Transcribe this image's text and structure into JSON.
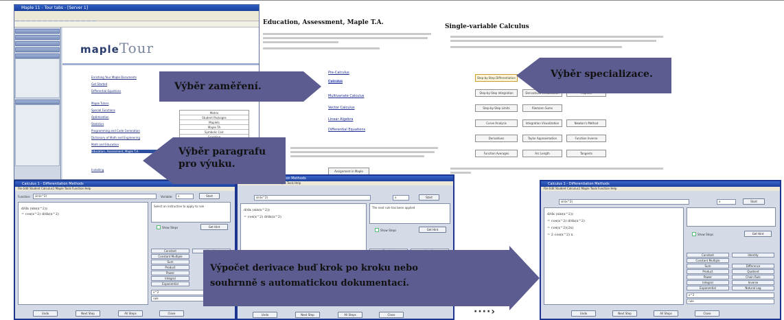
{
  "maple_window": {
    "title": "Maple 11 - Tour tabs - [Server 1]",
    "logo_small": "maple",
    "logo_large": "Tour",
    "topics": [
      "Enriching Your Maple Documents",
      "Get Started",
      "Differential Equations",
      "Maple Tutors",
      "Special Functions",
      "Optimization",
      "Statistics",
      "Programming and Code Generation",
      "Dictionary of Math and Engineering",
      "Math and Education",
      "Education, Assessment, Maple T.A.",
      "Installing"
    ],
    "table_rows": [
      "Matrix",
      "Student Packages",
      "Maplets",
      "Maple TA",
      "Symbolic Calc",
      "Graphing",
      "Applications",
      "Engineering",
      "Special Functions",
      "Systems Identification",
      "Signal Processing",
      "Learn More"
    ]
  },
  "page_education": {
    "heading": "Education, Assessment, Maple T.A.",
    "links": [
      "Pre-Calculus",
      "Calculus",
      "Multivariate Calculus",
      "Vector Calculus",
      "Linear Algebra",
      "Differential Equations"
    ],
    "button": "Assignment in Maple"
  },
  "page_calculus": {
    "heading": "Single-variable Calculus",
    "buttons": [
      "Step-by-Step Differentiation",
      "Step-by-Step Integration",
      "Derivatives Visualization",
      "Maplets",
      "Step-by-Step Limits",
      "Riemann Sums",
      "Curve Analysis",
      "Integration Visualization",
      "Newton's Method",
      "Derivatives",
      "Taylor Approximation",
      "Function Inverse",
      "Function Averages",
      "Arc Length",
      "Tangents"
    ]
  },
  "calc_windows": [
    {
      "title": "Calculus 1 - Differentiation Methods",
      "menu": "File  Edit  Student Calculus1  Maple Tools  Function  Help",
      "function_label": "Function:",
      "function_value": "sin(x^2)",
      "variable_label": "Variable:",
      "variable_value": "x",
      "start_label": "Start",
      "hint": "Select an instruction to apply to rule",
      "math": [
        "d/dx (sin(x^2))",
        "= cos(x^2) d/dx(x^2)"
      ],
      "show_steps_label": "Show Steps",
      "get_hint_label": "Get Hint",
      "rules": [
        "Constant",
        "Identity",
        "Constant Multiple",
        "Sum",
        "Difference",
        "Product",
        "Quotient",
        "Power",
        "Chain Rule",
        "Integral",
        "Inverse",
        "Exponential",
        "Natural Log"
      ],
      "dropdowns": [
        "x^2",
        "rule"
      ],
      "bottom": [
        "Undo",
        "Next Step",
        "All Steps",
        "Close"
      ]
    },
    {
      "title": "Calculus 1 - Differentiation Methods",
      "menu": "File  Edit  Student Calculus1  Maple Tools  Help",
      "function_value": "sin(x^2)",
      "variable_value": "x",
      "start_label": "Start",
      "hint": "The next rule has been applied",
      "math": [
        "d/dx (sin(x^2))",
        "= cos(x^2) d/dx(x^2)"
      ],
      "show_steps_label": "Show Steps",
      "get_hint_label": "Get Hint",
      "rules": [
        "Constant",
        "Identity"
      ],
      "bottom": [
        "Undo",
        "Next Step",
        "All Steps",
        "Close"
      ]
    },
    {
      "title": "Calculus 1 - Differentiation Methods",
      "menu": "File  Edit  Student Calculus1  Maple Tools  Function  Help",
      "function_value": "sin(x^2)",
      "variable_value": "x",
      "start_label": "Start",
      "math": [
        "d/dx (sin(x^2))",
        "= cos(x^2) d/dx(x^2)",
        "= cos(x^2)(2x)",
        "= 2 cos(x^2) x"
      ],
      "show_steps_label": "Show Steps",
      "get_hint_label": "Get Hint",
      "rules": [
        "Constant",
        "Identity",
        "Constant Multiple",
        "Sum",
        "Difference",
        "Product",
        "Quotient",
        "Power",
        "Chain Rule",
        "Integral",
        "Inverse",
        "Exponential",
        "Natural Log"
      ],
      "dropdowns": [
        "x^2",
        "rule"
      ],
      "bottom": [
        "Undo",
        "Next Step",
        "All Steps",
        "Close"
      ]
    }
  ],
  "callouts": {
    "focus": "Výběr zaměření.",
    "specialization": "Výběr specializace.",
    "paragraph_line1": "Výběr paragrafu",
    "paragraph_line2": "pro výuku.",
    "derivative_line1": "Výpočet derivace  buď krok po kroku nebo",
    "derivative_line2": "souhrnně s automatickou dokumentací."
  },
  "dots_arrow": "····›",
  "colors": {
    "callout": "#5c5c90",
    "window_title": "#1c3f9c",
    "link": "#1a2a90"
  }
}
